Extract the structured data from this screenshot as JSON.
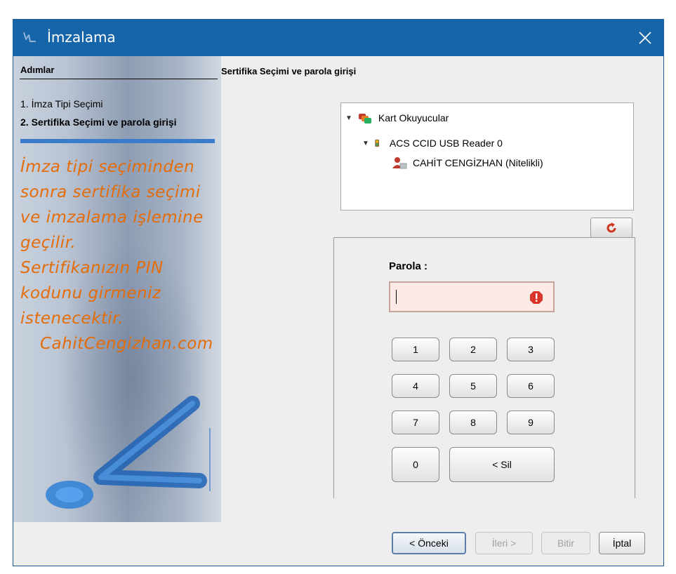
{
  "window": {
    "title": "İmzalama",
    "close_icon": "close-icon"
  },
  "steps": {
    "header": "Adımlar",
    "items": [
      "1. İmza Tipi Seçimi",
      "2. Sertifika Seçimi ve parola girişi"
    ],
    "info_lines": [
      "İmza tipi seçiminden",
      "sonra sertifika seçimi",
      "ve imzalama işlemine",
      "geçilir.",
      "Sertifikanızın PIN",
      "kodunu girmeniz",
      "istenecektir.",
      "CahitCengizhan.com"
    ]
  },
  "main": {
    "header": "Sertifika Seçimi ve parola girişi",
    "tree": {
      "root": "Kart Okuyucular",
      "reader": "ACS CCID USB Reader 0",
      "certificate": "CAHİT CENGİZHAN (Nitelikli)"
    },
    "password": {
      "label": "Parola :",
      "value": ""
    },
    "keypad": [
      "1",
      "2",
      "3",
      "4",
      "5",
      "6",
      "7",
      "8",
      "9",
      "0",
      "< Sil"
    ]
  },
  "buttons": {
    "previous": "< Önceki",
    "next": "İleri >",
    "finish": "Bitir",
    "cancel": "İptal"
  },
  "colors": {
    "title_bar": "#1565a8",
    "info_text": "#e46c0a",
    "step_bar": "#3a7cc9"
  }
}
